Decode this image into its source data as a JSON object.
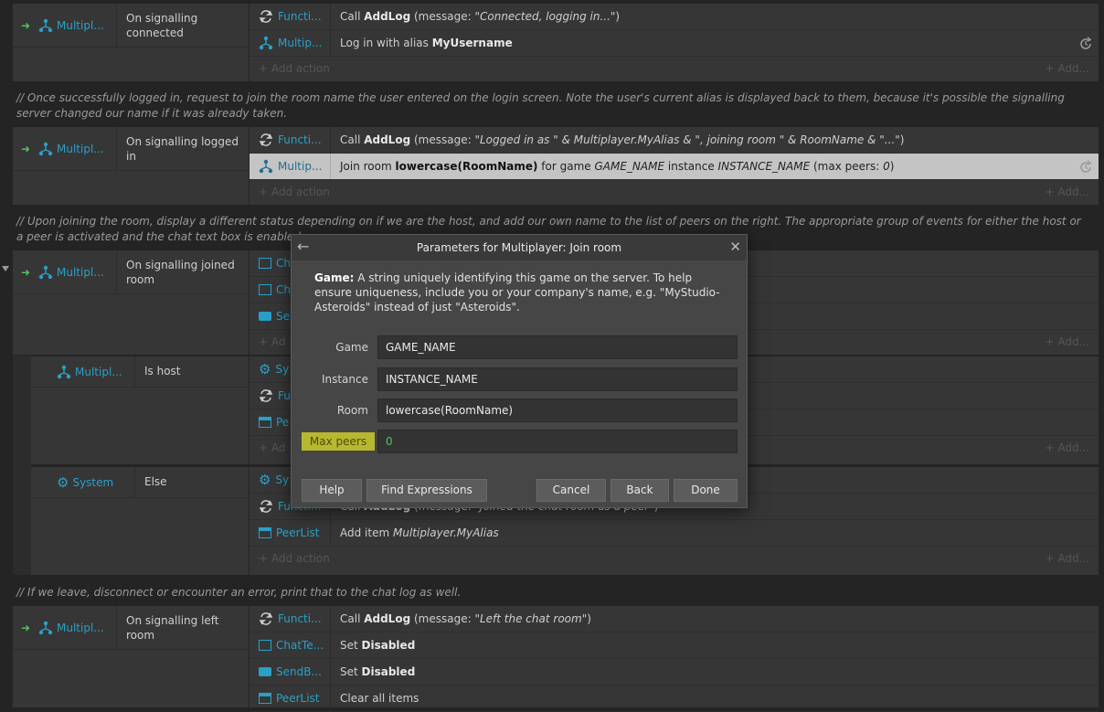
{
  "blocks": {
    "b1": {
      "cond_object": "Multipl...",
      "cond_text": "On signalling connected",
      "actions": [
        {
          "object": "Functi...",
          "text_pre": "Call ",
          "bold": "AddLog",
          "text_post": " (message: ",
          "italic": "\"Connected, logging in...\"",
          "tail": ")"
        },
        {
          "object": "Multip...",
          "text_pre": "Log in with alias ",
          "bold": "MyUsername",
          "text_post": "",
          "italic": "",
          "tail": ""
        }
      ],
      "add_action": "+ Add action",
      "add_more": "+ Add..."
    },
    "comment1": "//  Once successfully logged in, request to join the room name the user entered on the login screen. Note the user's current alias is displayed back to them, because it's possible the signalling server changed our name if it was already taken.",
    "b2": {
      "cond_object": "Multipl...",
      "cond_text": "On signalling logged in",
      "actions": [
        {
          "object": "Functi...",
          "text_pre": "Call ",
          "bold": "AddLog",
          "text_post": " (message: ",
          "italic": "\"Logged in as \" & Multiplayer.MyAlias & \", joining room \" & RoomName & \"...\"",
          "tail": ")"
        },
        {
          "object": "Multip...",
          "text_pre": "Join room ",
          "bold": "lowercase(RoomName)",
          "text_post": " for game ",
          "italic": "GAME_NAME",
          "tail": " instance ",
          "italic2": "INSTANCE_NAME",
          "tail2": " (max peers: ",
          "italic3": "0",
          "tail3": ")"
        }
      ],
      "add_action": "+ Add action",
      "add_more": "+ Add..."
    },
    "comment2": "//  Upon joining the room, display a different status depending on if we are the host, and add our own name to the list of peers on the right. The appropriate group of events for either the host or a peer is activated and the chat text box is enabled.",
    "b3": {
      "cond_object": "Multipl...",
      "cond_text": "On signalling joined room",
      "act_objects": [
        "Ch",
        "Ch",
        "Se"
      ],
      "add_action": "+ Ad",
      "add_more": "+ Add..."
    },
    "b3a": {
      "cond_object": "Multipl...",
      "cond_text": "Is host",
      "act_objects": [
        "Sy",
        "Fu",
        "Pe",
        "+ Ad"
      ],
      "add_more": "+ Add..."
    },
    "b3b": {
      "cond_object": "System",
      "cond_text": "Else",
      "act_obj_1": "Sy",
      "act2_object": "Functi...",
      "act2_pre": "Call ",
      "act2_bold": "AddLog",
      "act2_post": " (message: ",
      "act2_italic": "\"Joined the chat room as a peer\"",
      "act2_tail": ")",
      "act3_object": "PeerList",
      "act3_pre": "Add item ",
      "act3_italic": "Multiplayer.MyAlias",
      "add_action": "+ Add action",
      "add_more": "+ Add..."
    },
    "comment3": "//  If we leave, disconnect or encounter an error, print that to the chat log as well.",
    "b4": {
      "cond_object": "Multipl...",
      "cond_text": "On signalling left room",
      "a1_object": "Functi...",
      "a1_pre": "Call ",
      "a1_bold": "AddLog",
      "a1_post": " (message: ",
      "a1_italic": "\"Left the chat room\"",
      "a1_tail": ")",
      "a2_object": "ChatTe...",
      "a2_pre": "Set ",
      "a2_bold": "Disabled",
      "a3_object": "SendB...",
      "a3_pre": "Set ",
      "a3_bold": "Disabled",
      "a4_object": "PeerList",
      "a4_pre": "Clear all items"
    }
  },
  "dialog": {
    "title": "Parameters for Multiplayer: Join room",
    "desc_label": "Game:",
    "desc_text": " A string uniquely identifying this game on the server. To help ensure uniqueness, include you or your company's name, e.g. \"MyStudio-Asteroids\" instead of just \"Asteroids\".",
    "params": [
      {
        "label": "Game",
        "value": "GAME_NAME"
      },
      {
        "label": "Instance",
        "value": "INSTANCE_NAME"
      },
      {
        "label": "Room",
        "value": "lowercase(RoomName)"
      },
      {
        "label": "Max peers",
        "value": "0"
      }
    ],
    "buttons": {
      "help": "Help",
      "find": "Find Expressions",
      "cancel": "Cancel",
      "back": "Back",
      "done": "Done"
    }
  },
  "colors": {
    "accent_blue": "#2aa0c8",
    "trigger_green": "#4fc35f",
    "highlight": "#b8b830"
  }
}
